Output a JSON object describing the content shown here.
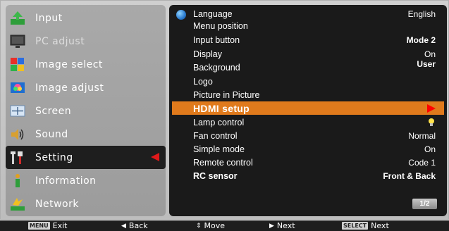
{
  "left_menu": {
    "items": [
      {
        "label": "Input",
        "icon": "input-icon"
      },
      {
        "label": "PC adjust",
        "icon": "pc-adjust-icon",
        "dim": true
      },
      {
        "label": "Image select",
        "icon": "image-select-icon"
      },
      {
        "label": "Image adjust",
        "icon": "image-adjust-icon"
      },
      {
        "label": "Screen",
        "icon": "screen-icon"
      },
      {
        "label": "Sound",
        "icon": "sound-icon"
      },
      {
        "label": "Setting",
        "icon": "setting-icon",
        "selected": true
      },
      {
        "label": "Information",
        "icon": "information-icon"
      },
      {
        "label": "Network",
        "icon": "network-icon"
      }
    ],
    "selected_color": "#e0191a"
  },
  "settings": {
    "rows": [
      {
        "label": "Language",
        "value": "English"
      },
      {
        "label": "Menu position",
        "value": ""
      },
      {
        "label": "Input button",
        "value": "Mode 2"
      },
      {
        "label": "Display",
        "value": "On"
      },
      {
        "label": "Background",
        "value": "User"
      },
      {
        "label": "Logo",
        "value": ""
      },
      {
        "label": "Picture in Picture",
        "value": ""
      },
      {
        "label": "HDMI setup",
        "value": ""
      },
      {
        "label": "Lamp control",
        "value": "",
        "icon": "lamp-icon"
      },
      {
        "label": "Fan control",
        "value": "Normal"
      },
      {
        "label": "Simple mode",
        "value": "On"
      },
      {
        "label": "Remote control",
        "value": "Code 1"
      },
      {
        "label": "RC sensor",
        "value": "Front & Back"
      }
    ],
    "highlight_color": "#e07a1c",
    "page": "1/2"
  },
  "bottom_bar": {
    "exit": {
      "badge": "MENU",
      "label": "Exit"
    },
    "back": {
      "glyph": "◀",
      "label": "Back"
    },
    "move": {
      "glyph": "⇕",
      "label": "Move"
    },
    "next": {
      "glyph": "▶",
      "label": "Next"
    },
    "select_next": {
      "badge": "SELECT",
      "label": "Next"
    }
  }
}
